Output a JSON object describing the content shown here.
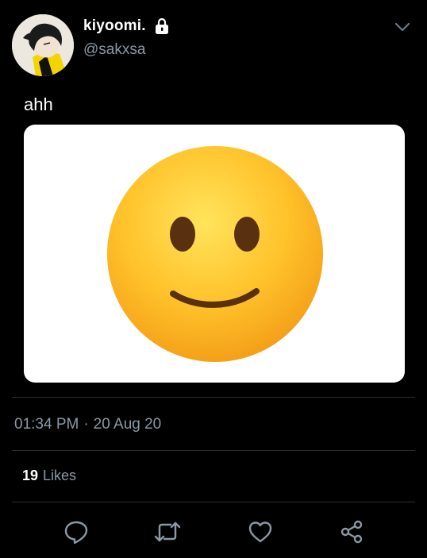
{
  "author": {
    "display_name": "kiyoomi.",
    "handle": "@sakxsa",
    "protected_icon": "lock-icon",
    "avatar": "avatar-illustration"
  },
  "menu_icon": "chevron-down-icon",
  "tweet": {
    "text": "ahh",
    "media": "slightly-smiling-face-emoji"
  },
  "meta": {
    "time": "01:34 PM",
    "separator": "·",
    "date": "20 Aug 20"
  },
  "stats": {
    "likes_count": "19",
    "likes_label": "Likes"
  },
  "actions": [
    {
      "name": "reply",
      "icon": "reply-icon"
    },
    {
      "name": "retweet",
      "icon": "retweet-icon"
    },
    {
      "name": "like",
      "icon": "heart-icon"
    },
    {
      "name": "share",
      "icon": "share-icon"
    }
  ],
  "colors": {
    "background": "#000000",
    "text": "#ffffff",
    "secondary": "#8b98a5",
    "divider": "#2a2f33",
    "emoji_yellow": "#ffcc33"
  }
}
